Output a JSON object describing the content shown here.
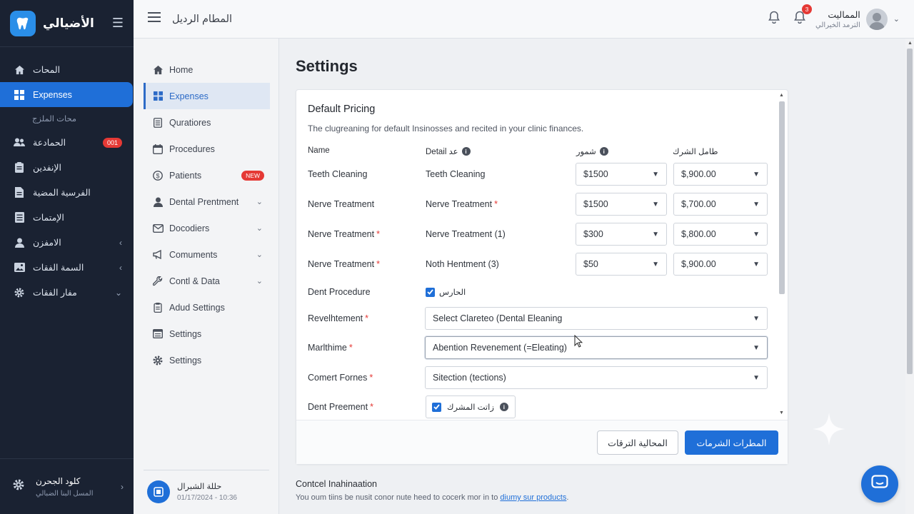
{
  "brand": {
    "name": "الأضيالي"
  },
  "dark_sidebar": {
    "items": [
      {
        "label": "المحات",
        "icon": "home-icon"
      },
      {
        "label": "Expenses",
        "icon": "grid-icon",
        "active": true
      },
      {
        "label": "محات الملزج",
        "sub": true
      },
      {
        "label": "الحمادعة",
        "icon": "users-icon",
        "badge": "001"
      },
      {
        "label": "الإنفدين",
        "icon": "clipboard-icon"
      },
      {
        "label": "الفرسية المضية",
        "icon": "document-icon"
      },
      {
        "label": "الإمتمات",
        "icon": "list-icon"
      },
      {
        "label": "الامفزن",
        "icon": "person-icon",
        "chevron": "‹"
      },
      {
        "label": "السمة الفقات",
        "icon": "image-icon",
        "chevron": "‹"
      },
      {
        "label": "مفار الفقات",
        "icon": "gear-icon",
        "chevron": "⌄"
      }
    ],
    "footer": {
      "title": "كلود الجحرن",
      "subtitle": "المسل البنا الضبالي"
    }
  },
  "header": {
    "title": "المطام الرديل",
    "notification_count": "3",
    "user_name": "المماليت",
    "user_role": "الترمد الخيرالي"
  },
  "secondary_sidebar": {
    "items": [
      {
        "label": "Home",
        "icon": "home-icon"
      },
      {
        "label": "Expenses",
        "icon": "grid-icon",
        "active": true
      },
      {
        "label": "Quratiores",
        "icon": "list-icon"
      },
      {
        "label": "Procedures",
        "icon": "calendar-icon"
      },
      {
        "label": "Patients",
        "icon": "coin-icon",
        "badge": "NEW"
      },
      {
        "label": "Dental Prentment",
        "icon": "person-icon",
        "chevron": true
      },
      {
        "label": "Docodiers",
        "icon": "mail-icon",
        "chevron": true
      },
      {
        "label": "Comuments",
        "icon": "megaphone-icon",
        "chevron": true
      },
      {
        "label": "Contl & Data",
        "icon": "wrench-icon",
        "chevron": true
      },
      {
        "label": "Adud Settings",
        "icon": "clipboard-icon"
      },
      {
        "label": "Settings",
        "icon": "table-icon"
      },
      {
        "label": "Settings",
        "icon": "gear-icon"
      }
    ],
    "footer": {
      "title": "حللة الشبرال",
      "timestamp": "01/17/2024 - 10:36"
    }
  },
  "main": {
    "page_title": "Settings",
    "card": {
      "title": "Default Pricing",
      "description": "The clugreaning for default Insinosses and recited in your clinic finances.",
      "columns": {
        "name": "Name",
        "detail": "Detail عد",
        "price": "شمور",
        "alt_price": "طامل الشرك"
      },
      "rows": [
        {
          "name": "Teeth Cleaning",
          "name_req": false,
          "detail": "Teeth Cleaning",
          "detail_req": false,
          "price": "$1500",
          "alt_price": "$,900.00"
        },
        {
          "name": "Nerve Treatment",
          "name_req": false,
          "detail": "Nerve Treatment",
          "detail_req": true,
          "price": "$1500",
          "alt_price": "$,700.00"
        },
        {
          "name": "Nerve Treatment",
          "name_req": true,
          "detail": "Nerve Treatment (1)",
          "detail_req": false,
          "price": "$300",
          "alt_price": "$,800.00"
        },
        {
          "name": "Nerve Treatment",
          "name_req": true,
          "detail": "Noth Hentment (3)",
          "detail_req": false,
          "price": "$50",
          "alt_price": "$,900.00"
        }
      ],
      "dent_procedure": {
        "label": "Dent Procedure",
        "checkbox_label": "الحارس",
        "checked": true
      },
      "fields": [
        {
          "label": "Revelhtement",
          "required": true,
          "value": "Select Clareteo (Dental Eleaning"
        },
        {
          "label": "Marlthime",
          "required": true,
          "value": "Abention Revenement (=Eleating)"
        },
        {
          "label": "Comert Fornes",
          "required": true,
          "value": "Sitection (tections)"
        }
      ],
      "dent_preement": {
        "label": "Dent Preement",
        "required": true,
        "checkbox_label": "زاتت المشرك",
        "checked": true
      },
      "secondary_button": "المحالية الترقات",
      "primary_button": "المطرات الشرمات"
    },
    "context": {
      "title": "Contcel Inahinaation",
      "text": "You oum tiins be nusit conor nute heed to cocerk mor in to",
      "link": "diumy sur products",
      "trailing": "."
    }
  },
  "colors": {
    "accent": "#1f6fd8",
    "sidebar_bg": "#1a2232",
    "badge": "#e53935"
  }
}
